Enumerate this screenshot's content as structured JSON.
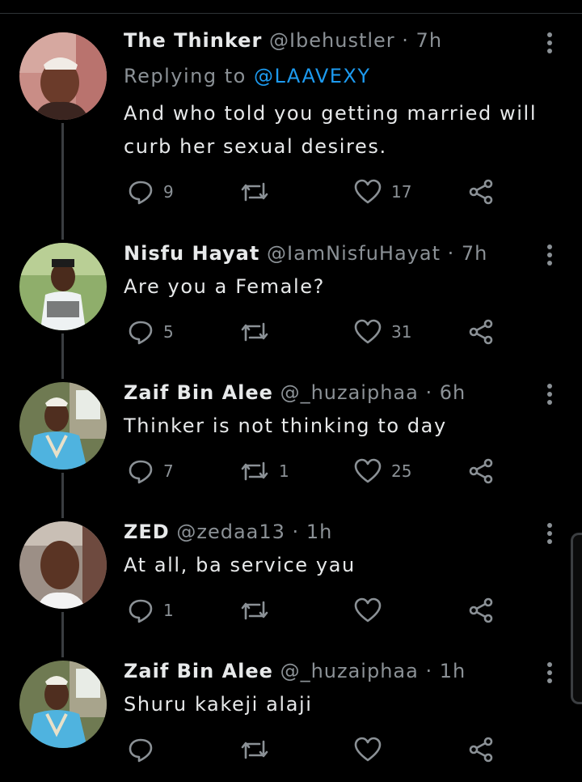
{
  "tweets": [
    {
      "name": "The Thinker",
      "handle": "@Ibehustler",
      "sep": " · ",
      "time": "7h",
      "replying_prefix": "Replying to ",
      "replying_to": "@LAAVEXY",
      "lines": [
        "And who told you getting married will",
        "curb her sexual desires."
      ],
      "reply_count": "9",
      "retweet_count": "",
      "like_count": "17"
    },
    {
      "name": "Nisfu Hayat",
      "handle": "@IamNisfuHayat",
      "sep": " · ",
      "time": "7h",
      "lines": [
        "Are you a Female?"
      ],
      "reply_count": "5",
      "retweet_count": "",
      "like_count": "31"
    },
    {
      "name": "Zaif Bin Alee",
      "handle": "@_huzaiphaa",
      "sep": " · ",
      "time": "6h",
      "lines": [
        "Thinker is not thinking to day"
      ],
      "reply_count": "7",
      "retweet_count": "1",
      "like_count": "25"
    },
    {
      "name": "ZED",
      "handle": "@zedaa13",
      "sep": " · ",
      "time": "1h",
      "lines": [
        "At all, ba service yau"
      ],
      "reply_count": "1",
      "retweet_count": "",
      "like_count": ""
    },
    {
      "name": "Zaif Bin Alee",
      "handle": "@_huzaiphaa",
      "sep": " · ",
      "time": "1h",
      "lines": [
        "Shuru kakeji alaji"
      ],
      "reply_count": "",
      "retweet_count": "",
      "like_count": ""
    }
  ],
  "colors": {
    "background": "#000000",
    "text": "#e7e9ea",
    "secondary": "#8b9196",
    "link": "#1d9bf0",
    "thread_line": "#3a3d40"
  },
  "icons": {
    "reply": "reply-icon",
    "retweet": "retweet-icon",
    "like": "heart-icon",
    "share": "share-icon",
    "more": "more-vertical-icon"
  }
}
